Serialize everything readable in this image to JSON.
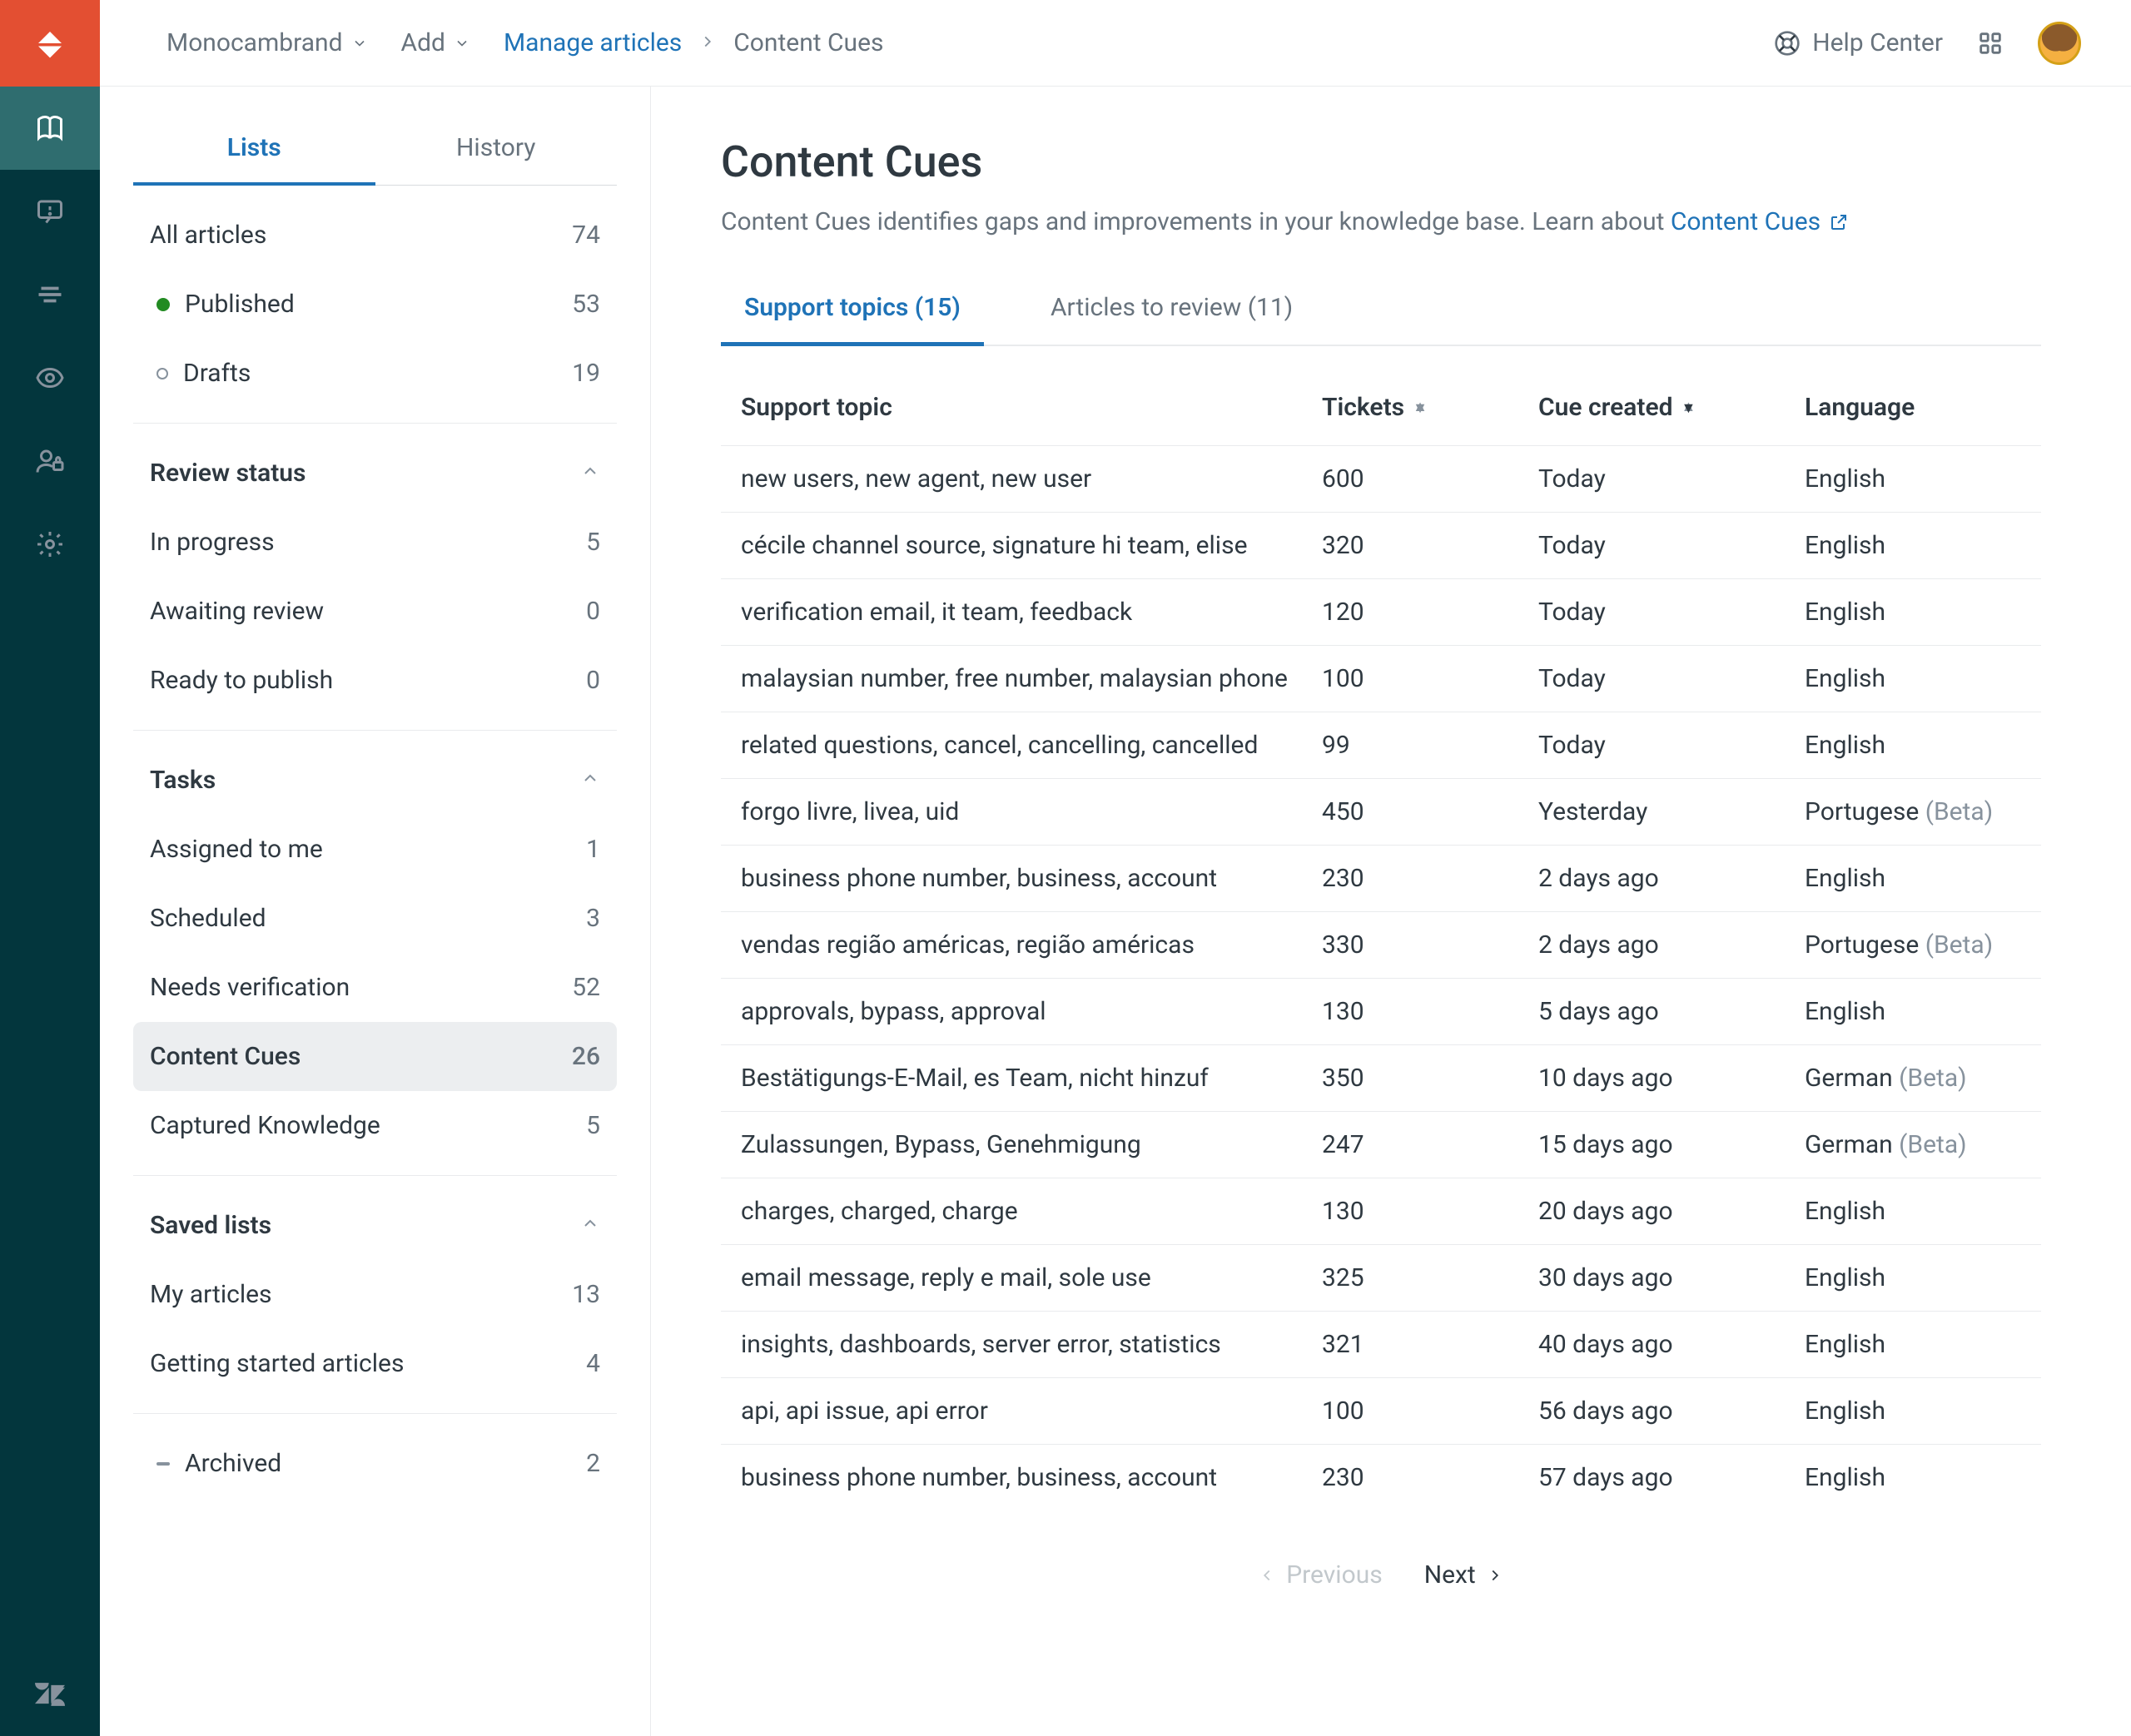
{
  "topbar": {
    "brand": "Monocambrand",
    "add": "Add",
    "breadcrumb_link": "Manage articles",
    "breadcrumb_current": "Content Cues",
    "help_center": "Help Center"
  },
  "sidebar": {
    "tabs": {
      "lists": "Lists",
      "history": "History"
    },
    "all": {
      "label": "All articles",
      "count": "74"
    },
    "published": {
      "label": "Published",
      "count": "53"
    },
    "drafts": {
      "label": "Drafts",
      "count": "19"
    },
    "review_header": "Review status",
    "review": [
      {
        "label": "In progress",
        "count": "5"
      },
      {
        "label": "Awaiting review",
        "count": "0"
      },
      {
        "label": "Ready to publish",
        "count": "0"
      }
    ],
    "tasks_header": "Tasks",
    "tasks": [
      {
        "label": "Assigned to me",
        "count": "1"
      },
      {
        "label": "Scheduled",
        "count": "3"
      },
      {
        "label": "Needs verification",
        "count": "52"
      },
      {
        "label": "Content Cues",
        "count": "26"
      },
      {
        "label": "Captured Knowledge",
        "count": "5"
      }
    ],
    "saved_header": "Saved lists",
    "saved": [
      {
        "label": "My articles",
        "count": "13"
      },
      {
        "label": "Getting started articles",
        "count": "4"
      }
    ],
    "archived": {
      "label": "Archived",
      "count": "2"
    }
  },
  "main": {
    "title": "Content Cues",
    "description_pre": "Content Cues identifies gaps and improvements in your knowledge base. Learn about ",
    "description_link": "Content Cues",
    "tabs": {
      "support_topics": "Support topics (15)",
      "articles_review": "Articles to review (11)"
    },
    "columns": {
      "topic": "Support topic",
      "tickets": "Tickets",
      "created": "Cue created",
      "language": "Language"
    },
    "rows": [
      {
        "topic": "new users, new agent, new user",
        "tickets": "600",
        "created": "Today",
        "language": "English",
        "beta": ""
      },
      {
        "topic": "cécile channel source, signature hi team, elise",
        "tickets": "320",
        "created": "Today",
        "language": "English",
        "beta": ""
      },
      {
        "topic": "verification email, it team, feedback",
        "tickets": "120",
        "created": "Today",
        "language": "English",
        "beta": ""
      },
      {
        "topic": "malaysian number, free number, malaysian phone",
        "tickets": "100",
        "created": "Today",
        "language": "English",
        "beta": ""
      },
      {
        "topic": "related questions, cancel, cancelling, cancelled",
        "tickets": "99",
        "created": "Today",
        "language": "English",
        "beta": ""
      },
      {
        "topic": "forgo livre, livea, uid",
        "tickets": "450",
        "created": "Yesterday",
        "language": "Portugese",
        "beta": "(Beta)"
      },
      {
        "topic": "business phone number, business, account",
        "tickets": "230",
        "created": "2 days ago",
        "language": "English",
        "beta": ""
      },
      {
        "topic": "vendas região américas, região américas",
        "tickets": "330",
        "created": "2 days ago",
        "language": "Portugese",
        "beta": "(Beta)"
      },
      {
        "topic": "approvals, bypass, approval",
        "tickets": "130",
        "created": "5 days ago",
        "language": "English",
        "beta": ""
      },
      {
        "topic": "Bestätigungs-E-Mail, es Team, nicht hinzuf",
        "tickets": "350",
        "created": "10 days ago",
        "language": "German",
        "beta": "(Beta)"
      },
      {
        "topic": "Zulassungen, Bypass, Genehmigung",
        "tickets": "247",
        "created": "15 days ago",
        "language": "German",
        "beta": "(Beta)"
      },
      {
        "topic": "charges, charged, charge",
        "tickets": "130",
        "created": "20 days ago",
        "language": "English",
        "beta": ""
      },
      {
        "topic": "email message, reply e mail, sole use",
        "tickets": "325",
        "created": "30 days ago",
        "language": "English",
        "beta": ""
      },
      {
        "topic": "insights, dashboards, server error, statistics",
        "tickets": "321",
        "created": "40 days ago",
        "language": "English",
        "beta": ""
      },
      {
        "topic": "api, api issue, api error",
        "tickets": "100",
        "created": "56 days ago",
        "language": "English",
        "beta": ""
      },
      {
        "topic": "business phone number, business, account",
        "tickets": "230",
        "created": "57 days ago",
        "language": "English",
        "beta": ""
      }
    ],
    "pager": {
      "prev": "Previous",
      "next": "Next"
    }
  }
}
